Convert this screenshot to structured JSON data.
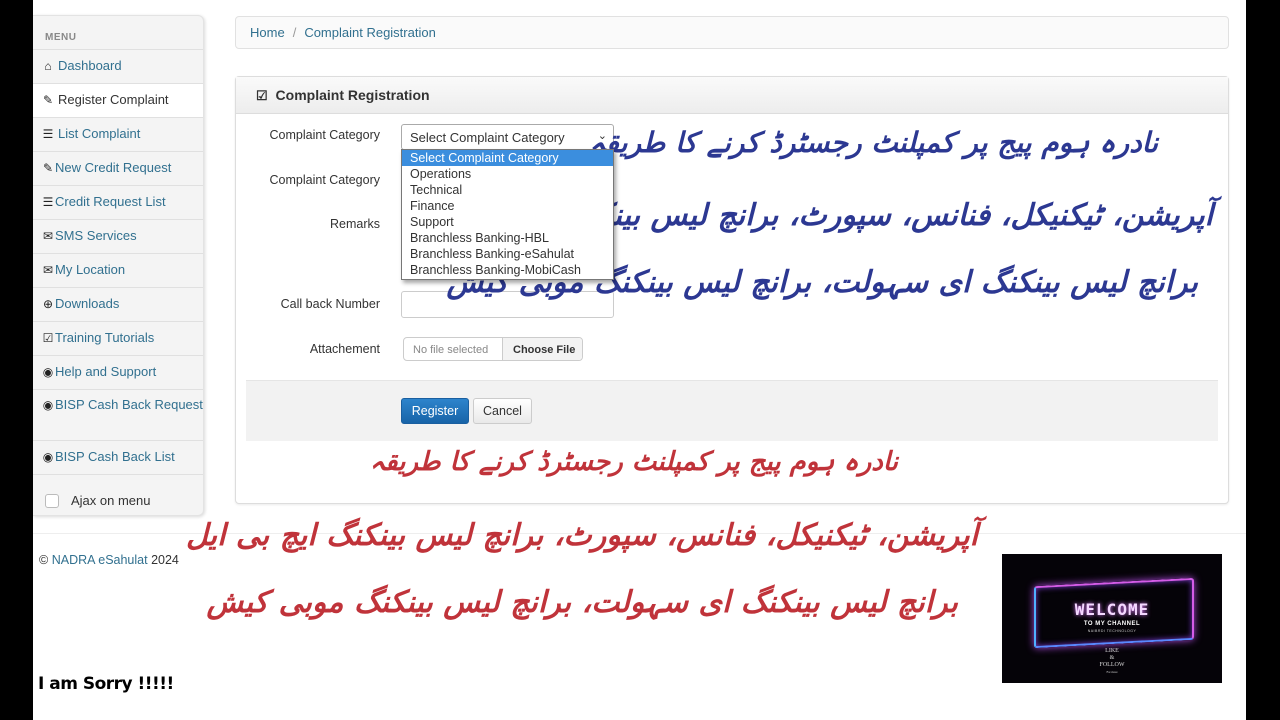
{
  "sidebar": {
    "header": "MENU",
    "items": [
      {
        "label": "Dashboard",
        "icon": "home-icon",
        "glyph": "⌂"
      },
      {
        "label": "Register Complaint",
        "icon": "pencil-icon",
        "glyph": "✎"
      },
      {
        "label": "List Complaint",
        "icon": "list-icon",
        "glyph": "☰"
      },
      {
        "label": "New Credit Request",
        "icon": "pencil-icon",
        "glyph": "✎"
      },
      {
        "label": "Credit Request List",
        "icon": "list-icon",
        "glyph": "☰"
      },
      {
        "label": "SMS Services",
        "icon": "envelope-icon",
        "glyph": "✉"
      },
      {
        "label": "My Location",
        "icon": "envelope-icon",
        "glyph": "✉"
      },
      {
        "label": "Downloads",
        "icon": "download-icon",
        "glyph": "⊕"
      },
      {
        "label": "Training Tutorials",
        "icon": "check-square-icon",
        "glyph": "☑"
      },
      {
        "label": "Help and Support",
        "icon": "eye-icon",
        "glyph": "◉"
      },
      {
        "label": "BISP Cash Back Request",
        "icon": "eye-icon",
        "glyph": "◉"
      },
      {
        "label": "BISP Cash Back List",
        "icon": "eye-icon",
        "glyph": "◉"
      }
    ],
    "active_index": 1,
    "ajax_label": "Ajax on menu",
    "ajax_checked": false
  },
  "breadcrumb": {
    "home": "Home",
    "separator": "/",
    "current": "Complaint Registration"
  },
  "panel": {
    "title": "Complaint Registration",
    "title_icon": "edit-icon",
    "title_glyph": "☑"
  },
  "form": {
    "category_label": "Complaint Category",
    "subcategory_label": "Complaint Category",
    "remarks_label": "Remarks",
    "callback_label": "Call back Number",
    "callback_value": "",
    "attachment_label": "Attachement",
    "category_selected": "Select Complaint Category",
    "category_options": [
      "Select Complaint Category",
      "Operations",
      "Technical",
      "Finance",
      "Support",
      "Branchless Banking-HBL",
      "Branchless Banking-eSahulat",
      "Branchless Banking-MobiCash"
    ],
    "file_placeholder": "No file selected",
    "choose_file_label": "Choose File",
    "register_label": "Register",
    "cancel_label": "Cancel"
  },
  "footer": {
    "copyright": "©",
    "brand": "NADRA eSahulat",
    "year": "2024"
  },
  "overlay": {
    "urdu_title": "نادرہ ہوم پیج پر کمپلنٹ رجسٹرڈ کرنے کا طریقہ",
    "urdu_line2": "آپریشن، ٹیکنیکل، فنانس، سپورٹ، برانچ لیس بینکنگ ایچ بی ایل",
    "urdu_line3": "برانچ لیس بینکنگ ای سہولت، برانچ لیس بینکنگ موبی کیش",
    "sorry_text": "I am Sorry !!!!!",
    "blue_color": "#2c3892",
    "red_color": "#c0333a"
  },
  "thumbnail": {
    "title": "WELCOME",
    "subtitle": "TO MY CHANNEL",
    "channel": "NAIBRDI TECHNOLOGY",
    "like": "LIKE",
    "amp": "&",
    "follow": "FOLLOW",
    "small": "For more"
  }
}
